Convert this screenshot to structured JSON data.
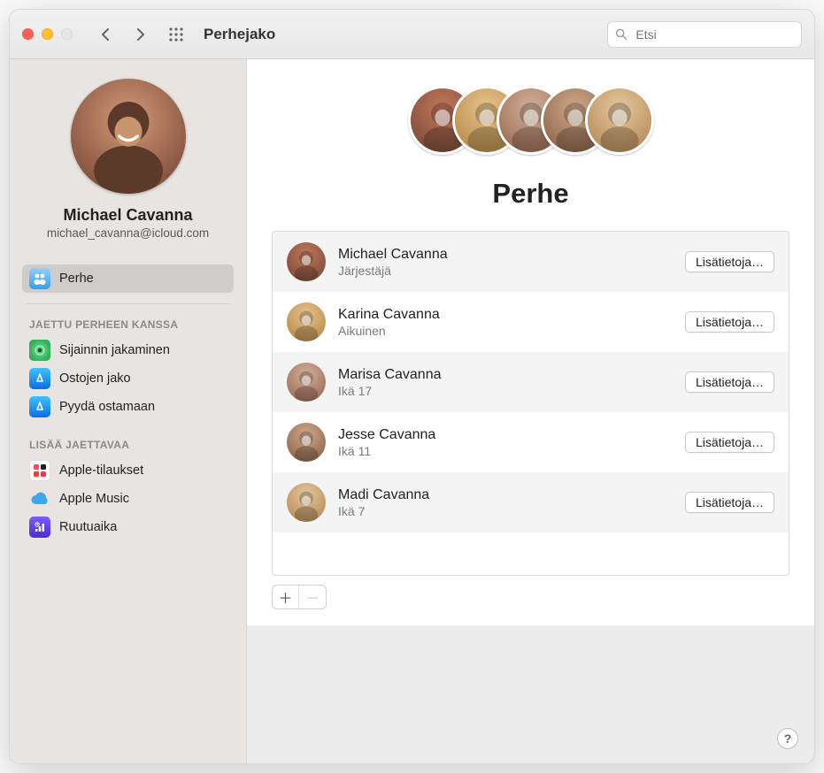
{
  "window": {
    "title": "Perhejako"
  },
  "search": {
    "placeholder": "Etsi"
  },
  "sidebar": {
    "profile": {
      "name": "Michael Cavanna",
      "email": "michael_cavanna@icloud.com",
      "avatar_color_top": "#c1775a",
      "avatar_color_bottom": "#7a4a38"
    },
    "primary_label": "Perhe",
    "section1_heading": "JAETTU PERHEEN KANSSA",
    "section1": {
      "location": "Sijainnin jakaminen",
      "purchases": "Ostojen jako",
      "ask": "Pyydä ostamaan"
    },
    "section2_heading": "LISÄÄ JAETTAVAA",
    "section2": {
      "subs": "Apple-tilaukset",
      "music": "Apple Music",
      "screentime": "Ruutuaika"
    }
  },
  "content": {
    "title": "Perhe",
    "details_label": "Lisätietoja…",
    "members": [
      {
        "name": "Michael Cavanna",
        "sub": "Järjestäjä",
        "c1": "#c1775a",
        "c2": "#7a4a38"
      },
      {
        "name": "Karina Cavanna",
        "sub": "Aikuinen",
        "c1": "#e6c28b",
        "c2": "#b78a4a"
      },
      {
        "name": "Marisa Cavanna",
        "sub": "Ikä 17",
        "c1": "#d1b09a",
        "c2": "#9b6a53"
      },
      {
        "name": "Jesse Cavanna",
        "sub": "Ikä 11",
        "c1": "#cfa98a",
        "c2": "#8c6348"
      },
      {
        "name": "Madi Cavanna",
        "sub": "Ikä 7",
        "c1": "#e4c79e",
        "c2": "#b68a58"
      }
    ]
  }
}
